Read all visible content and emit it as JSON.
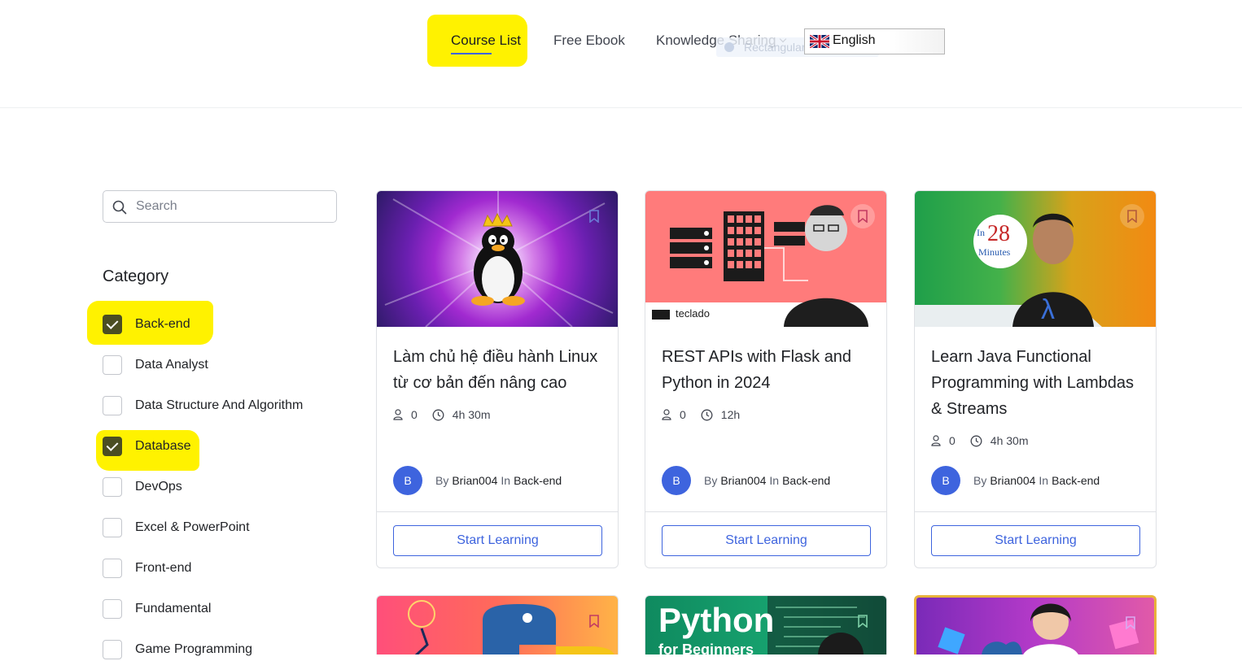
{
  "nav": {
    "items": [
      {
        "label": "Course List"
      },
      {
        "label": "Free Ebook"
      },
      {
        "label": "Knowledge Sharing"
      }
    ],
    "ghost_label": "Rectangular Snip",
    "language": {
      "label": "English",
      "icon": "uk-flag-icon"
    }
  },
  "sidebar": {
    "search_placeholder": "Search",
    "category_title": "Category",
    "categories": [
      {
        "label": "Back-end",
        "checked": true
      },
      {
        "label": "Data Analyst",
        "checked": false
      },
      {
        "label": "Data Structure And Algorithm",
        "checked": false
      },
      {
        "label": "Database",
        "checked": true
      },
      {
        "label": "DevOps",
        "checked": false
      },
      {
        "label": "Excel & PowerPoint",
        "checked": false
      },
      {
        "label": "Front-end",
        "checked": false
      },
      {
        "label": "Fundamental",
        "checked": false
      },
      {
        "label": "Game Programming",
        "checked": false
      }
    ]
  },
  "courses": [
    {
      "title": "Làm chủ hệ điều hành Linux từ cơ bản đến nâng cao",
      "students": "0",
      "duration": "4h 30m",
      "avatar": "B",
      "by": "By",
      "author": "Brian004",
      "in": "In",
      "category": "Back-end",
      "button": "Start Learning"
    },
    {
      "title": "REST APIs with Flask and Python in 2024",
      "students": "0",
      "duration": "12h",
      "avatar": "B",
      "by": "By",
      "author": "Brian004",
      "in": "In",
      "category": "Back-end",
      "button": "Start Learning",
      "thumb_text": "teclado"
    },
    {
      "title": "Learn Java Functional Programming with Lambdas & Streams",
      "students": "0",
      "duration": "4h 30m",
      "avatar": "B",
      "by": "By",
      "author": "Brian004",
      "in": "In",
      "category": "Back-end",
      "button": "Start Learning",
      "thumb_text": {
        "in": "In",
        "num": "28",
        "minutes": "Minutes",
        "lambda": "λ"
      }
    },
    {
      "title": "",
      "thumb_icon": "python-logo-icon"
    },
    {
      "title": "",
      "thumb_text": {
        "big": "Python",
        "small": "for Beginners"
      }
    },
    {
      "title": "",
      "thumb_icon": "python-logo-icon"
    }
  ],
  "colors": {
    "accent": "#3e64de",
    "highlight": "#fff200",
    "checkbox": "#4b4e22"
  }
}
